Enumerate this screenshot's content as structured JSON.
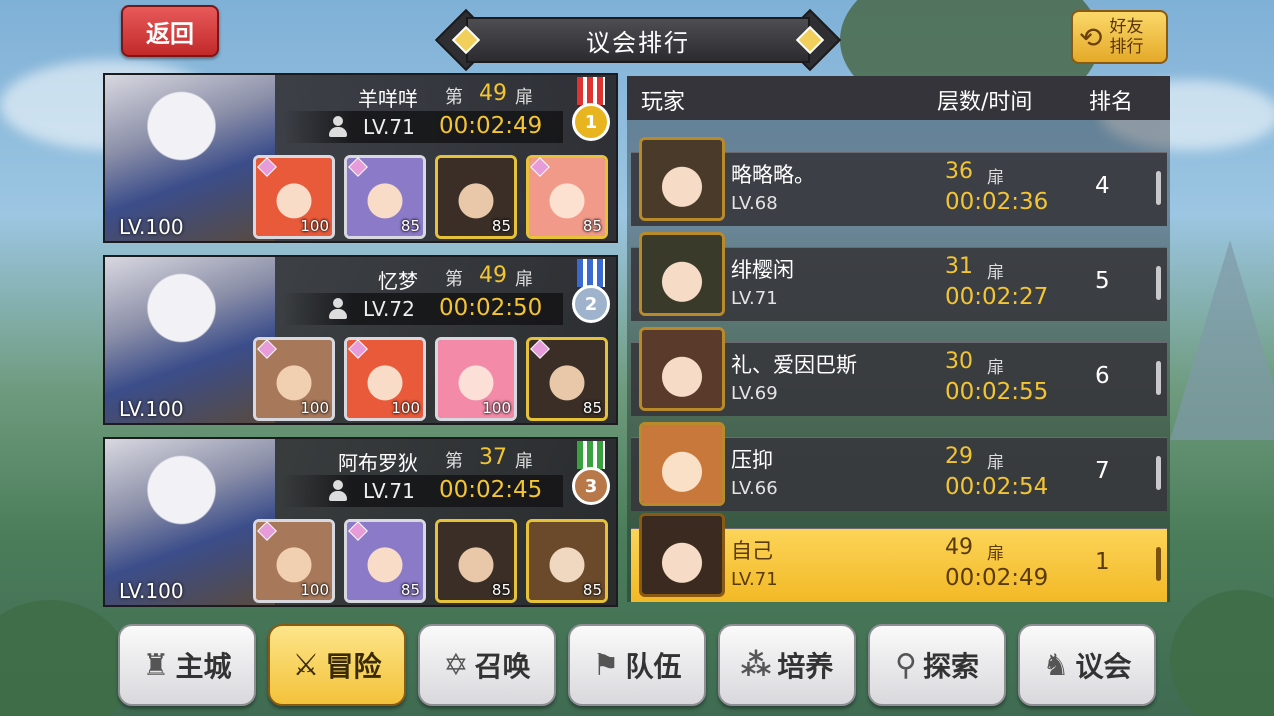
{
  "header": {
    "back_label": "返回",
    "title": "议会排行",
    "friend_label_1": "好友",
    "friend_label_2": "排行"
  },
  "top_three": [
    {
      "name": "羊咩咩",
      "di": "第",
      "floor": "49",
      "floor_unit": "扉",
      "level": "LV.71",
      "time": "00:02:49",
      "hero_level": "LV.100",
      "medal": "1",
      "team": [
        {
          "level": "100",
          "color": "#e85a3a"
        },
        {
          "level": "85",
          "color": "#8b7ac8"
        },
        {
          "level": "85",
          "color": "#5a4a3a"
        },
        {
          "level": "85",
          "color": "#f29a8a"
        }
      ]
    },
    {
      "name": "忆梦",
      "di": "第",
      "floor": "49",
      "floor_unit": "扉",
      "level": "LV.72",
      "time": "00:02:50",
      "hero_level": "LV.100",
      "medal": "2",
      "team": [
        {
          "level": "100",
          "color": "#a8785a"
        },
        {
          "level": "100",
          "color": "#e85a3a"
        },
        {
          "level": "100",
          "color": "#f28aa8"
        },
        {
          "level": "85",
          "color": "#5a4a3a"
        }
      ]
    },
    {
      "name": "阿布罗狄",
      "di": "第",
      "floor": "37",
      "floor_unit": "扉",
      "level": "LV.71",
      "time": "00:02:45",
      "hero_level": "LV.100",
      "medal": "3",
      "team": [
        {
          "level": "100",
          "color": "#a8785a"
        },
        {
          "level": "85",
          "color": "#8b7ac8"
        },
        {
          "level": "85",
          "color": "#5a4a3a"
        },
        {
          "level": "85",
          "color": "#8a6a4a"
        }
      ]
    }
  ],
  "ranking": {
    "columns": {
      "player": "玩家",
      "floor_time": "层数/时间",
      "rank": "排名"
    },
    "rows": [
      {
        "name": "略略略。",
        "level": "LV.68",
        "floor": "36",
        "unit": "扉",
        "time": "00:02:36",
        "rank": "4",
        "avatar_color": "#4a3a2a"
      },
      {
        "name": "绯樱闲",
        "level": "LV.71",
        "floor": "31",
        "unit": "扉",
        "time": "00:02:27",
        "rank": "5",
        "avatar_color": "#3a3a2a"
      },
      {
        "name": "礼、爱因巴斯",
        "level": "LV.69",
        "floor": "30",
        "unit": "扉",
        "time": "00:02:55",
        "rank": "6",
        "avatar_color": "#5a3a2a"
      },
      {
        "name": "压抑",
        "level": "LV.66",
        "floor": "29",
        "unit": "扉",
        "time": "00:02:54",
        "rank": "7",
        "avatar_color": "#c8783a"
      }
    ],
    "self": {
      "name": "自己",
      "level": "LV.71",
      "floor": "49",
      "unit": "扉",
      "time": "00:02:49",
      "rank": "1",
      "avatar_color": "#3a2a20"
    }
  },
  "nav": [
    {
      "label": "主城",
      "icon": "castle-icon"
    },
    {
      "label": "冒险",
      "icon": "crossed-swords-icon",
      "active": true
    },
    {
      "label": "召唤",
      "icon": "hexagram-icon"
    },
    {
      "label": "队伍",
      "icon": "team-flag-icon"
    },
    {
      "label": "培养",
      "icon": "orbs-icon"
    },
    {
      "label": "探索",
      "icon": "explorer-icon"
    },
    {
      "label": "议会",
      "icon": "dragon-crest-icon"
    }
  ],
  "colors": {
    "gold": "#f4c532",
    "medal_gold": "#e8b520",
    "medal_silver": "#9fb4cc",
    "medal_bronze": "#b8784a"
  }
}
